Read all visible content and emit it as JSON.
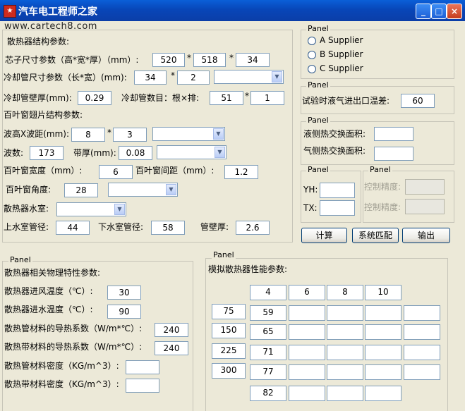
{
  "window": {
    "title": "汽车电工程师之家",
    "watermark": "www.cartech8.com",
    "controls": {
      "minimize": "_",
      "maximize": "□",
      "close": "×"
    }
  },
  "multiply_sign": "*",
  "structure": {
    "title": "散热器结构参数:",
    "core_label": "芯子尺寸参数（高*宽*厚）（mm）:",
    "core_values": [
      "520",
      "518",
      "34"
    ],
    "tube_label": "冷却管尺寸参数（长*宽）(mm):",
    "tube_values": [
      "34",
      "2"
    ],
    "wall_label": "冷却管壁厚(mm):",
    "wall_value": "0.29",
    "count_label": "冷却管数目：根×排:",
    "count_values": [
      "51",
      "1"
    ],
    "louver_title": "百叶窗翅片结构参数:",
    "wave_label": "波高X波距(mm):",
    "wave_values": [
      "8",
      "3"
    ],
    "wave_num_label": "波数:",
    "wave_num_value": "173",
    "strip_label": "带厚(mm):",
    "strip_value": "0.08",
    "louver_width_label": "百叶窗宽度（mm）:",
    "louver_width_value": "6",
    "louver_gap_label": "百叶窗间距（mm）:",
    "louver_gap_value": "1.2",
    "louver_angle_label": "百叶窗角度:",
    "louver_angle_value": "28",
    "tank_label": "散热器水室:",
    "upper_label": "上水室管径:",
    "upper_value": "44",
    "lower_label": "下水室管径:",
    "lower_value": "58",
    "pipe_wall_label": "管壁厚:",
    "pipe_wall_value": "2.6"
  },
  "supplier_panel": {
    "title": "Panel",
    "options": [
      "A Supplier",
      "B Supplier",
      "C Supplier"
    ]
  },
  "temp_panel": {
    "title": "Panel",
    "label": "试验时液气进出口温差:",
    "value": "60"
  },
  "area_panel": {
    "title": "Panel",
    "liquid_label": "液侧热交换面积:",
    "liquid_value": "",
    "gas_label": "气侧热交换面积:",
    "gas_value": ""
  },
  "yh_panel": {
    "title": "Panel",
    "yh_label": "YH:",
    "tx_label": "TX:"
  },
  "precision_panel": {
    "title": "Panel",
    "label1": "控制精度:",
    "label2": "控制精度:"
  },
  "buttons": {
    "calculate": "计算",
    "match": "系统匹配",
    "output": "输出"
  },
  "physical_panel": {
    "title": "Panel",
    "heading": "散热器相关物理特性参数:",
    "air_temp_label": "散热器进风温度（℃）:",
    "air_temp_value": "30",
    "water_temp_label": "散热器进水温度（℃）:",
    "water_temp_value": "90",
    "tube_cond_label": "散热管材料的导热系数（W/m*℃）:",
    "tube_cond_value": "240",
    "strip_cond_label": "散热带材料的导热系数（W/m*℃）:",
    "strip_cond_value": "240",
    "tube_density_label": "散热管材料密度（KG/m^3）:",
    "tube_density_value": "",
    "strip_density_label": "散热带材料密度（KG/m^3）:",
    "strip_density_value": ""
  },
  "performance_panel": {
    "title": "Panel",
    "heading": "模拟散热器性能参数:",
    "columns": [
      "4",
      "6",
      "8",
      "10"
    ],
    "rows": [
      "75",
      "150",
      "225",
      "300"
    ],
    "col0": [
      "59",
      "65",
      "71",
      "77",
      "82"
    ]
  }
}
